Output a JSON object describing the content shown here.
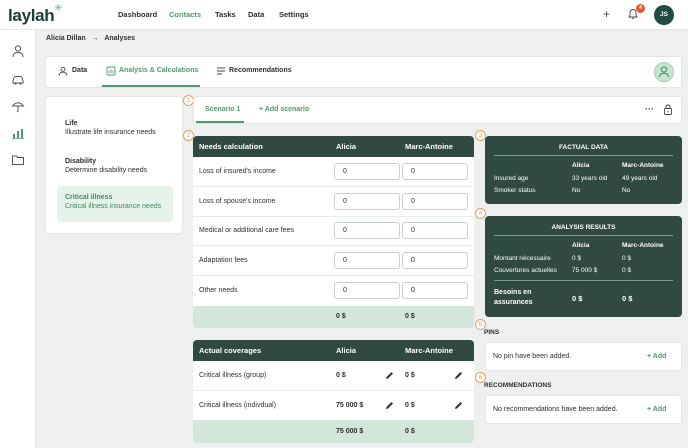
{
  "app": {
    "logo": "laylah"
  },
  "topnav": {
    "items": [
      {
        "label": "Dashboard",
        "active": false
      },
      {
        "label": "Contacts",
        "active": true
      },
      {
        "label": "Tasks",
        "active": false
      },
      {
        "label": "Data",
        "active": false
      },
      {
        "label": "Settings",
        "active": false
      }
    ],
    "notifications": "4",
    "user_initials": "JS"
  },
  "breadcrumb": {
    "contact": "Alicia Dillan",
    "separator": "→",
    "page": "Analyses"
  },
  "tabs": [
    {
      "label": "Data",
      "icon": "person-icon",
      "active": false
    },
    {
      "label": "Analysis & Calculations",
      "icon": "calculator-chart-icon",
      "active": true
    },
    {
      "label": "Recommendations",
      "icon": "list-icon",
      "active": false
    }
  ],
  "needs": [
    {
      "title": "Life",
      "subtitle": "Illustrate life insurance needs",
      "active": false
    },
    {
      "title": "Disability",
      "subtitle": "Determine disability needs",
      "active": false
    },
    {
      "title": "Critical illness",
      "subtitle": "Critical illness insurance needs",
      "active": true
    }
  ],
  "steps": [
    "1",
    "2",
    "3",
    "4",
    "5",
    "6"
  ],
  "scenario": {
    "active_tab": "Scenario 1",
    "add_label": "+ Add scenario",
    "more": "···"
  },
  "needs_calc": {
    "headers": [
      "Needs calculation",
      "Alicia",
      "Marc-Antoine"
    ],
    "rows": [
      {
        "label": "Loss of insured's income",
        "alicia": "0",
        "marc": "0"
      },
      {
        "label": "Loss of spouse's income",
        "alicia": "0",
        "marc": "0"
      },
      {
        "label": "Medical or additional care fees",
        "alicia": "0",
        "marc": "0"
      },
      {
        "label": "Adaptation fees",
        "alicia": "0",
        "marc": "0"
      },
      {
        "label": "Other needs",
        "alicia": "0",
        "marc": "0"
      }
    ],
    "total": {
      "alicia": "0 $",
      "marc": "0 $"
    }
  },
  "coverages": {
    "headers": [
      "Actual coverages",
      "Alicia",
      "Marc-Antoine"
    ],
    "rows": [
      {
        "label": "Critical illness (group)",
        "alicia": "0 $",
        "marc": "0 $"
      },
      {
        "label": "Critical illness (indivdual)",
        "alicia": "75 000 $",
        "marc": "0 $"
      }
    ],
    "total": {
      "alicia": "75 000 $",
      "marc": "0 $"
    }
  },
  "factual": {
    "title": "FACTUAL DATA",
    "cols": [
      "Alicia",
      "Marc-Antoine"
    ],
    "rows": [
      {
        "label": "Insured age",
        "alicia": "33 years old",
        "marc": "49 years old"
      },
      {
        "label": "Smoker status",
        "alicia": "No",
        "marc": "No"
      }
    ]
  },
  "analysis": {
    "title": "ANALYSIS RESULTS",
    "cols": [
      "Alicia",
      "Marc-Antoine"
    ],
    "rows": [
      {
        "label": "Montant nécessaire",
        "alicia": "0 $",
        "marc": "0 $"
      },
      {
        "label": "Couvertures actuelles",
        "alicia": "75 000 $",
        "marc": "0 $"
      }
    ],
    "result": {
      "label_line1": "Besoins en",
      "label_line2": "assurances",
      "alicia": "0 $",
      "marc": "0 $"
    }
  },
  "pins": {
    "title": "PINS",
    "empty": "No pin have been added.",
    "add": "+ Add"
  },
  "recommendations": {
    "title": "RECOMMENDATIONS",
    "empty": "No recommendations have been added.",
    "add": "+ Add"
  },
  "colors": {
    "accent": "#4f9a6a",
    "dark": "#304a43",
    "step": "#e2a167",
    "badge": "#e0592a"
  }
}
